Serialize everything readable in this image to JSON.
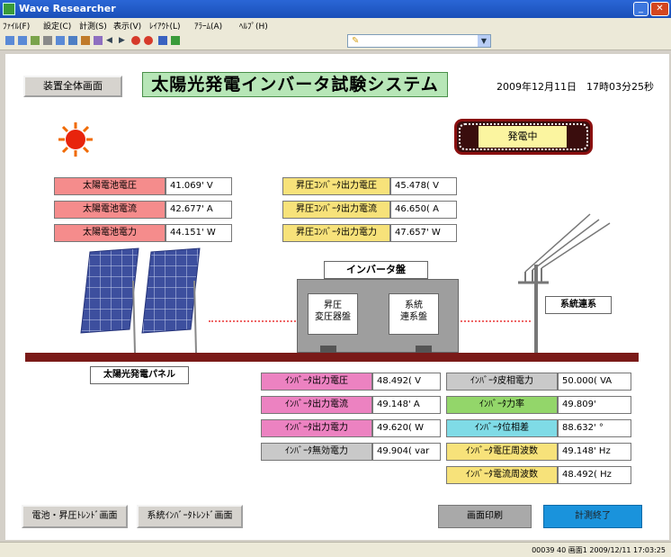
{
  "window": {
    "title": "Wave Researcher"
  },
  "menu": [
    "ﾌｧｲﾙ(F)",
    "設定(C)",
    "計測(S)",
    "表示(V)",
    "ﾚｲｱｳﾄ(L)",
    "ｱﾗｰﾑ(A)",
    "ﾍﾙﾌﾟ(H)"
  ],
  "header": {
    "overview_button": "装置全体画面",
    "title": "太陽光発電インバータ試験システム",
    "datetime": "2009年12月11日　17時03分25秒"
  },
  "status": {
    "badge": "発電中"
  },
  "solar": [
    {
      "label": "太陽電池電圧",
      "value": "41.069' V"
    },
    {
      "label": "太陽電池電流",
      "value": "42.677' A"
    },
    {
      "label": "太陽電池電力",
      "value": "44.151' W"
    }
  ],
  "boost": [
    {
      "label": "昇圧ｺﾝﾊﾞｰﾀ出力電圧",
      "value": "45.478( V"
    },
    {
      "label": "昇圧ｺﾝﾊﾞｰﾀ出力電流",
      "value": "46.650( A"
    },
    {
      "label": "昇圧ｺﾝﾊﾞｰﾀ出力電力",
      "value": "47.657' W"
    }
  ],
  "diagram": {
    "inverter_panel": "インバータ盤",
    "boost_transformer": [
      "昇圧",
      "変圧器盤"
    ],
    "grid_interconnect_panel": [
      "系統",
      "連系盤"
    ],
    "grid_connection": "系統連系",
    "solar_panel": "太陽光発電パネル"
  },
  "inverter_left": [
    {
      "label": "ｲﾝﾊﾞｰﾀ出力電圧",
      "value": "48.492( V"
    },
    {
      "label": "ｲﾝﾊﾞｰﾀ出力電流",
      "value": "49.148' A"
    },
    {
      "label": "ｲﾝﾊﾞｰﾀ出力電力",
      "value": "49.620( W"
    },
    {
      "label": "ｲﾝﾊﾞｰﾀ無効電力",
      "value": "49.904( var"
    }
  ],
  "inverter_right": [
    {
      "label": "ｲﾝﾊﾞｰﾀ皮相電力",
      "value": "50.000( VA"
    },
    {
      "label": "ｲﾝﾊﾞｰﾀ力率",
      "value": "49.809'"
    },
    {
      "label": "ｲﾝﾊﾞｰﾀ位相差",
      "value": "88.632' °"
    },
    {
      "label": "ｲﾝﾊﾞｰﾀ電圧周波数",
      "value": "49.148' Hz"
    },
    {
      "label": "ｲﾝﾊﾞｰﾀ電流周波数",
      "value": "48.492( Hz"
    }
  ],
  "footer": {
    "trend_battery": "電池・昇圧ﾄﾚﾝﾄﾞ画面",
    "trend_grid": "系統ｲﾝﾊﾞｰﾀﾄﾚﾝﾄﾞ画面",
    "print": "画面印刷",
    "end": "計測終了"
  },
  "statusbar": {
    "text": "00039  40  画面1  2009/12/11  17:03:25"
  },
  "colors": {
    "title_bg": "#b7e6b7",
    "solar_label": "#f58c8c",
    "boost_label": "#f7e27a",
    "inverter_label": "#ec82c1",
    "reactive_label": "#c9c9c9",
    "apparent_label": "#93d66a",
    "phase_label": "#7fdbe6",
    "end_button": "#1a93dc"
  }
}
